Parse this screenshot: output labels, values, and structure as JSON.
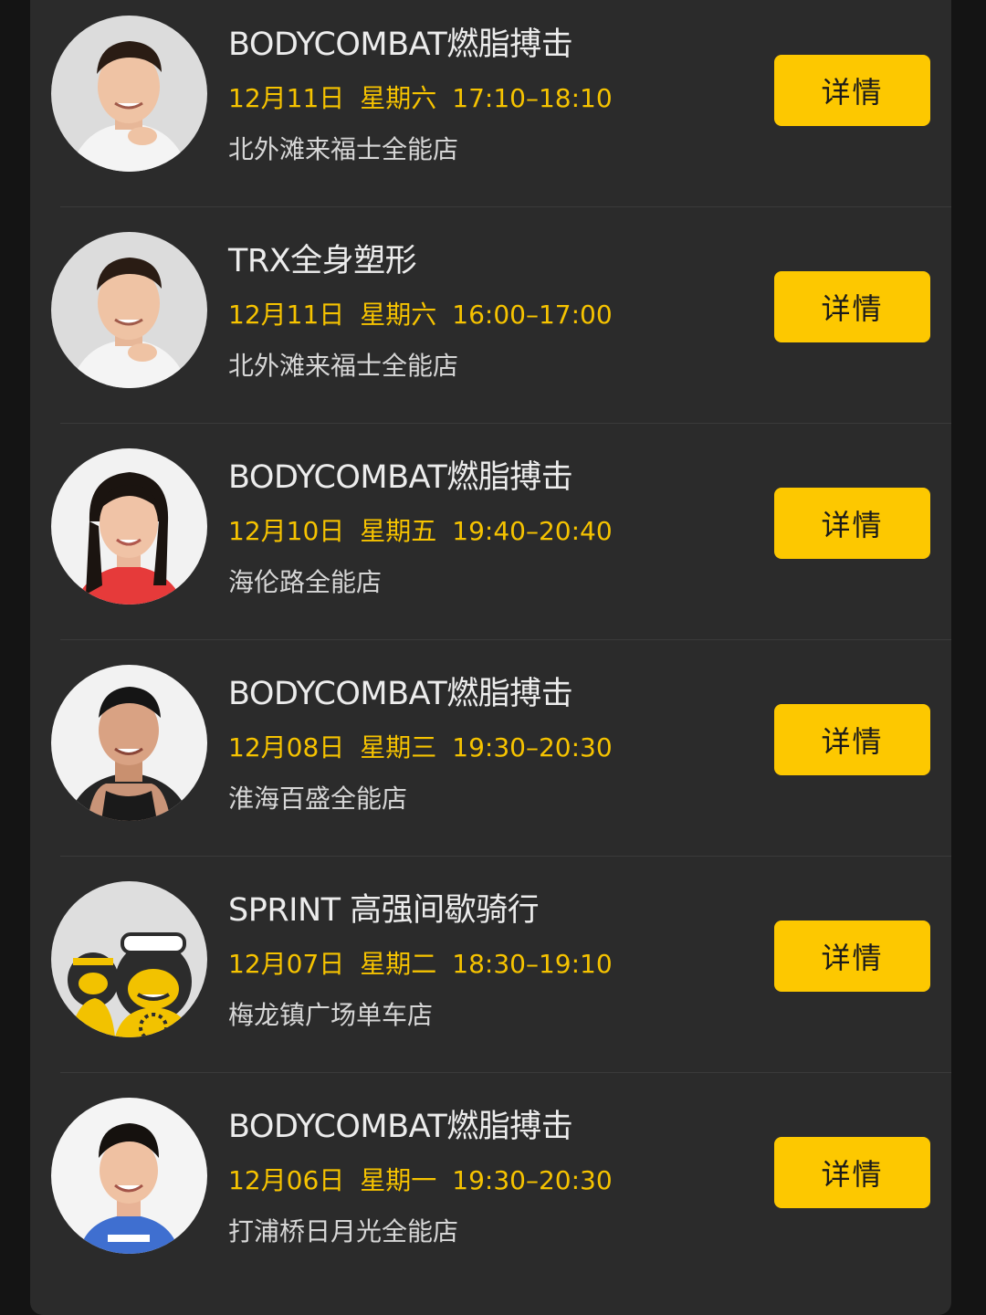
{
  "detail_label": "详情",
  "classes": [
    {
      "title": "BODYCOMBAT燃脂搏击",
      "date": "12月11日",
      "weekday": "星期六",
      "time": "17:10–18:10",
      "store": "北外滩来福士全能店",
      "avatar": "male-coach-1"
    },
    {
      "title": "TRX全身塑形",
      "date": "12月11日",
      "weekday": "星期六",
      "time": "16:00–17:00",
      "store": "北外滩来福士全能店",
      "avatar": "male-coach-1"
    },
    {
      "title": "BODYCOMBAT燃脂搏击",
      "date": "12月10日",
      "weekday": "星期五",
      "time": "19:40–20:40",
      "store": "海伦路全能店",
      "avatar": "female-coach-1"
    },
    {
      "title": "BODYCOMBAT燃脂搏击",
      "date": "12月08日",
      "weekday": "星期三",
      "time": "19:30–20:30",
      "store": "淮海百盛全能店",
      "avatar": "male-coach-2"
    },
    {
      "title": "SPRINT 高强间歇骑行",
      "date": "12月07日",
      "weekday": "星期二",
      "time": "18:30–19:10",
      "store": "梅龙镇广场单车店",
      "avatar": "cartoon-gorilla-mascot"
    },
    {
      "title": "BODYCOMBAT燃脂搏击",
      "date": "12月06日",
      "weekday": "星期一",
      "time": "19:30–20:30",
      "store": "打浦桥日月光全能店",
      "avatar": "female-coach-2"
    }
  ],
  "colors": {
    "background": "#141414",
    "panel": "#2b2b2b",
    "accent_yellow": "#fdc800",
    "meta_text": "#f6c300"
  }
}
